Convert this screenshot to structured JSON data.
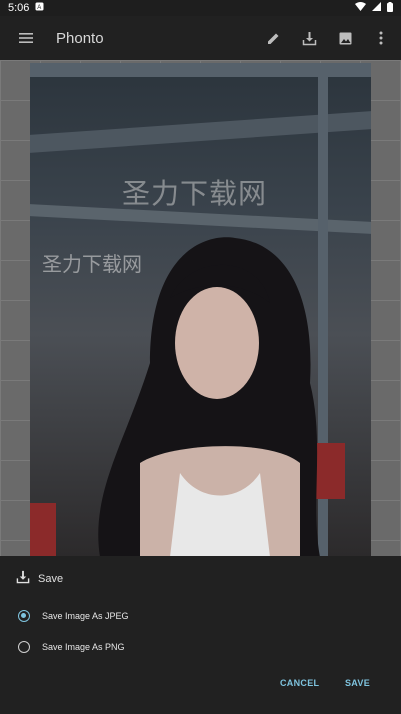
{
  "status": {
    "time": "5:06"
  },
  "app": {
    "title": "Phonto"
  },
  "actions": {
    "edit_icon": "pencil-icon",
    "download_icon": "download-icon",
    "image_icon": "image-icon",
    "menu_icon": "more-vert-icon"
  },
  "photo": {
    "watermark_large": "圣力下载网",
    "watermark_small": "圣力下载网"
  },
  "sheet": {
    "title": "Save",
    "options": [
      {
        "label": "Save Image As JPEG",
        "selected": true
      },
      {
        "label": "Save Image As PNG",
        "selected": false
      }
    ],
    "cancel_label": "CANCEL",
    "save_label": "SAVE"
  },
  "colors": {
    "accent": "#7fc4df",
    "appbar": "#212121",
    "sheet": "#212121"
  }
}
